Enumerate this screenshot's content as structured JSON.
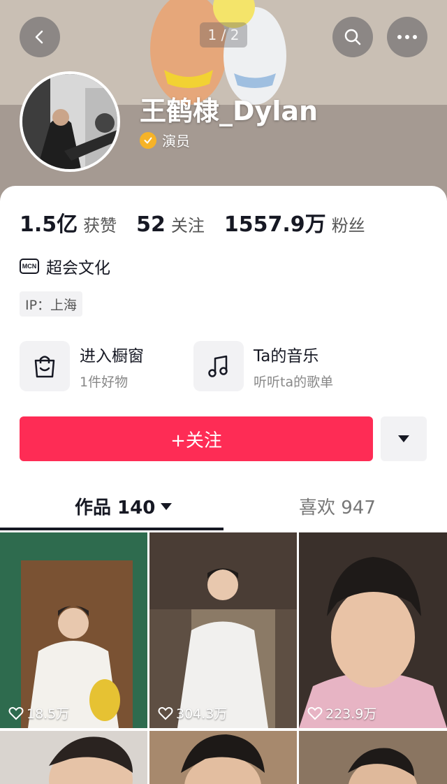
{
  "header": {
    "page_indicator": "1 / 2",
    "username": "王鹤棣_Dylan",
    "verify_label": "演员"
  },
  "stats": [
    {
      "value": "1.5亿",
      "label": "获赞"
    },
    {
      "value": "52",
      "label": "关注"
    },
    {
      "value": "1557.9万",
      "label": "粉丝"
    }
  ],
  "mcn": {
    "icon_text": "MCN",
    "name": "超会文化"
  },
  "ip": "IP：上海",
  "entries": [
    {
      "title": "进入橱窗",
      "subtitle": "1件好物",
      "icon": "shopping-bag-icon"
    },
    {
      "title": "Ta的音乐",
      "subtitle": "听听ta的歌单",
      "icon": "music-note-icon"
    }
  ],
  "follow_label": "+关注",
  "tabs": {
    "works": "作品 140",
    "likes": "喜欢 947"
  },
  "videos": [
    {
      "likes": "18.5万"
    },
    {
      "likes": "304.3万"
    },
    {
      "likes": "223.9万"
    }
  ],
  "colors": {
    "accent": "#fe2c55",
    "verify": "#f6b327"
  }
}
